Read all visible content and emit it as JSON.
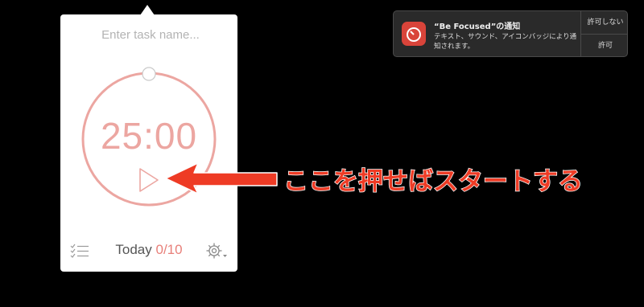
{
  "popover": {
    "task_placeholder": "Enter task name...",
    "timer": "25:00",
    "today_label": "Today",
    "today_count": "0/10"
  },
  "annotation": {
    "text": "ここを押せばスタートする"
  },
  "notification": {
    "title": "“Be Focused”の通知",
    "body": "テキスト、サウンド、アイコンバッジにより通知されます。",
    "deny_label": "許可しない",
    "allow_label": "許可"
  },
  "colors": {
    "accent": "#eca6a1",
    "arrow": "#ee3b25",
    "notification_bg": "#2a2a2a"
  },
  "icons": [
    "play-icon",
    "list-icon",
    "gear-icon",
    "app-icon"
  ]
}
